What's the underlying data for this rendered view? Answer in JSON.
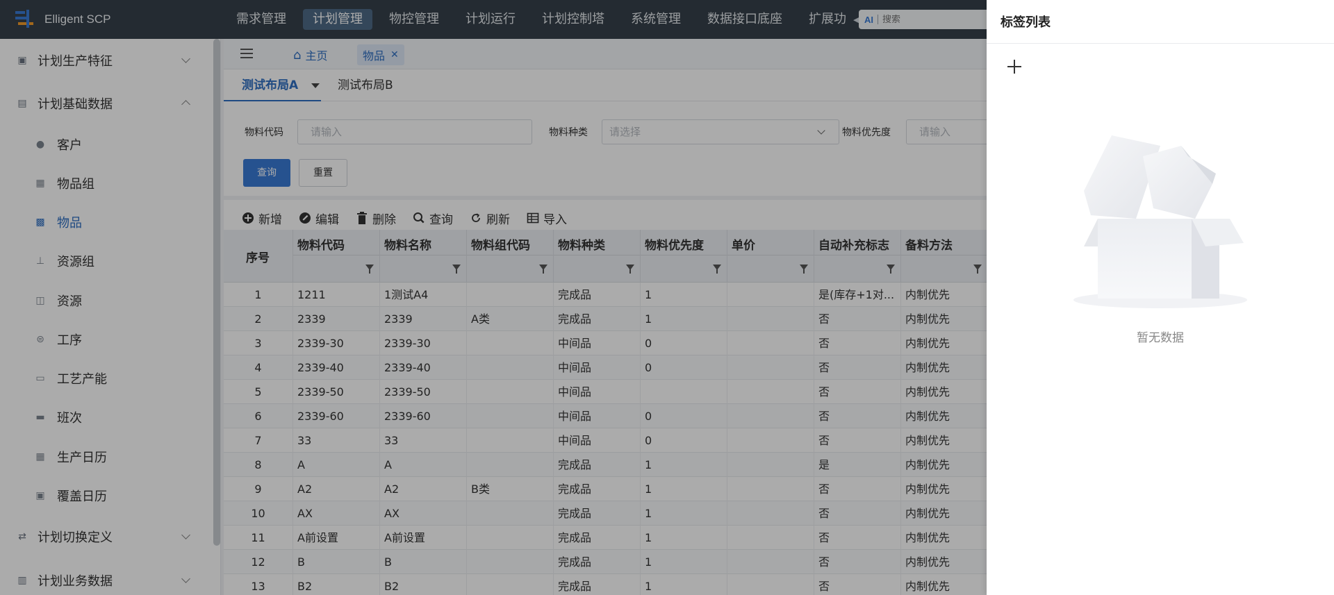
{
  "app": {
    "name": "Elligent SCP",
    "brand_color": "#2f6fc2",
    "topbar_color": "#36404b"
  },
  "topnav": {
    "items": [
      "需求管理",
      "计划管理",
      "物控管理",
      "计划运行",
      "计划控制塔",
      "系统管理",
      "数据接口底座",
      "扩展功"
    ],
    "active": "计划管理",
    "search_ai": "AI",
    "search_placeholder": "搜索"
  },
  "sidebar": {
    "groups": [
      {
        "label": "计划生产特征",
        "icon": "clipboard-icon",
        "expanded": false
      },
      {
        "label": "计划基础数据",
        "icon": "database-icon",
        "expanded": true
      },
      {
        "label": "计划切换定义",
        "icon": "switch-icon",
        "expanded": false
      },
      {
        "label": "计划业务数据",
        "icon": "document-icon",
        "expanded": false
      }
    ],
    "items": [
      {
        "label": "客户",
        "icon": "user-icon"
      },
      {
        "label": "物品组",
        "icon": "grid-icon"
      },
      {
        "label": "物品",
        "icon": "box-icon"
      },
      {
        "label": "资源组",
        "icon": "resource-group-icon"
      },
      {
        "label": "资源",
        "icon": "cart-icon"
      },
      {
        "label": "工序",
        "icon": "process-icon"
      },
      {
        "label": "工艺产能",
        "icon": "capacity-icon"
      },
      {
        "label": "班次",
        "icon": "shift-icon"
      },
      {
        "label": "生产日历",
        "icon": "calendar-icon"
      },
      {
        "label": "覆盖日历",
        "icon": "calendar-override-icon"
      }
    ],
    "active_item": "物品"
  },
  "tabs": {
    "home": "主页",
    "current": "物品"
  },
  "layouts": {
    "a": "测试布局A",
    "b": "测试布局B"
  },
  "filters": {
    "code_label": "物料代码",
    "code_placeholder": "请输入",
    "type_label": "物料种类",
    "type_placeholder": "请选择",
    "priority_label": "物料优先度",
    "priority_placeholder": "请输入",
    "query": "查询",
    "reset": "重置"
  },
  "toolbar": {
    "add": "新增",
    "edit": "编辑",
    "delete": "删除",
    "query": "查询",
    "refresh": "刷新",
    "import": "导入"
  },
  "table": {
    "columns": [
      "序号",
      "物料代码",
      "物料名称",
      "物料组代码",
      "物料种类",
      "物料优先度",
      "单价",
      "自动补充标志",
      "备料方法"
    ],
    "rows": [
      [
        "1",
        "1211",
        "1测试A4",
        "",
        "完成品",
        "1",
        "",
        "是(库存+1对...",
        "内制优先"
      ],
      [
        "2",
        "2339",
        "2339",
        "A类",
        "完成品",
        "1",
        "",
        "否",
        "内制优先"
      ],
      [
        "3",
        "2339-30",
        "2339-30",
        "",
        "中间品",
        "0",
        "",
        "否",
        "内制优先"
      ],
      [
        "4",
        "2339-40",
        "2339-40",
        "",
        "中间品",
        "0",
        "",
        "否",
        "内制优先"
      ],
      [
        "5",
        "2339-50",
        "2339-50",
        "",
        "中间品",
        "",
        "",
        "否",
        "内制优先"
      ],
      [
        "6",
        "2339-60",
        "2339-60",
        "",
        "中间品",
        "0",
        "",
        "否",
        "内制优先"
      ],
      [
        "7",
        "33",
        "33",
        "",
        "中间品",
        "0",
        "",
        "否",
        "内制优先"
      ],
      [
        "8",
        "A",
        "A",
        "",
        "完成品",
        "1",
        "",
        "是",
        "内制优先"
      ],
      [
        "9",
        "A2",
        "A2",
        "B类",
        "完成品",
        "1",
        "",
        "否",
        "内制优先"
      ],
      [
        "10",
        "AX",
        "AX",
        "",
        "完成品",
        "1",
        "",
        "否",
        "内制优先"
      ],
      [
        "11",
        "A前设置",
        "A前设置",
        "",
        "完成品",
        "1",
        "",
        "否",
        "内制优先"
      ],
      [
        "12",
        "B",
        "B",
        "",
        "完成品",
        "1",
        "",
        "否",
        "内制优先"
      ],
      [
        "13",
        "B2",
        "B2",
        "",
        "完成品",
        "1",
        "",
        "否",
        "内制优先"
      ]
    ]
  },
  "drawer": {
    "title": "标签列表",
    "empty_text": "暂无数据"
  }
}
